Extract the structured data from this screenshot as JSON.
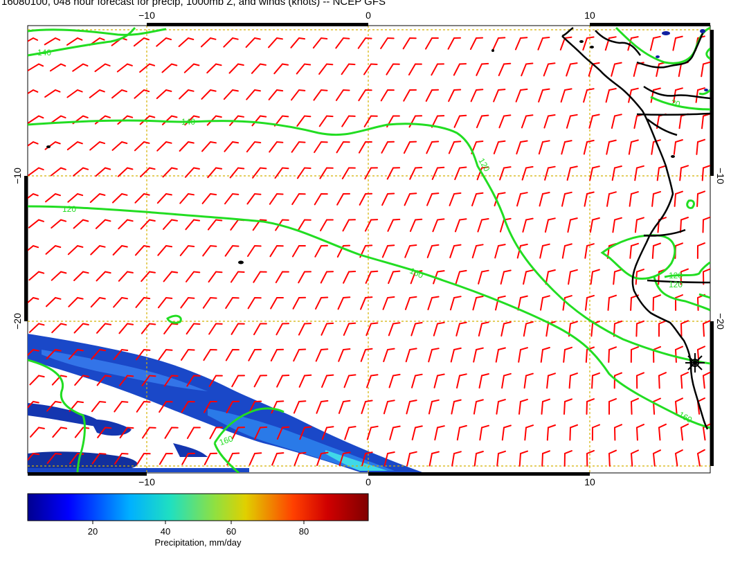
{
  "title": "16080100, 048 hour forecast for precip, 1000mb Z, and winds (knots) -- NCEP GFS",
  "map": {
    "lon_ticks_top": [
      "−10",
      "0",
      "10"
    ],
    "lon_ticks_bottom": [
      "−10",
      "0",
      "10"
    ],
    "lat_ticks_left": [
      "−10",
      "−20"
    ],
    "lat_ticks_right": [
      "−10",
      "−20"
    ],
    "contour_labels": [
      {
        "text": "140"
      },
      {
        "text": "140"
      },
      {
        "text": "120"
      },
      {
        "text": "120"
      },
      {
        "text": "160"
      },
      {
        "text": "160"
      },
      {
        "text": "160"
      },
      {
        "text": "120"
      },
      {
        "text": "120"
      },
      {
        "text": "20"
      }
    ]
  },
  "colorbar": {
    "ticks": [
      "20",
      "40",
      "60",
      "80"
    ],
    "label": "Precipitation, mm/day"
  },
  "colors": {
    "wind_barb": "#ff0000",
    "contour": "#22dd22",
    "coastline": "#000000",
    "grid": "#d4b000"
  }
}
